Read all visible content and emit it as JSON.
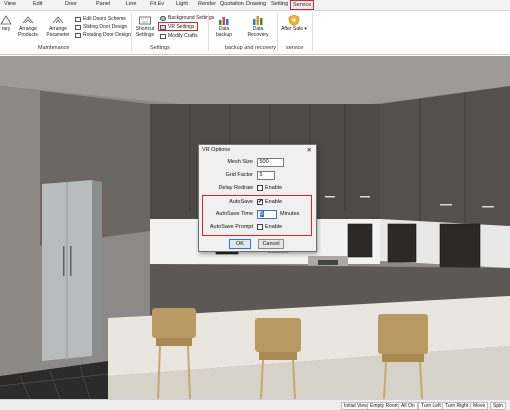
{
  "menu": {
    "items": [
      "View",
      "Edit",
      "Door",
      "Panel",
      "Line",
      "Fit Ev",
      "Light",
      "Render",
      "Quotation",
      "Drawing",
      "Setting",
      "Service"
    ],
    "active": "Service"
  },
  "ribbon": {
    "ary_label": "rary",
    "arrange_products": "Arrange Products",
    "arrange_parameter": "Arrange Parameter",
    "edit_doors_scheme": "Edit Doors Scheme",
    "sliding_door_design": "Sliding Door Design",
    "rotating_door_design": "Rotating Door Design",
    "shortcut_settings": "Shortcut Settings",
    "background_settings": "Background Settings",
    "vr_settings": "VR Settings",
    "modify_crafts": "Modify Crafts",
    "data_backup": "Data backup",
    "data_recovery": "Data Recovery",
    "after_sale": "After Sale ▾",
    "groups": {
      "maintenance": "Maintenance",
      "settings": "Settings",
      "backup": "backup and recovery",
      "service": "service"
    }
  },
  "dialog": {
    "title": "VR Options",
    "close": "✕",
    "mesh_size_label": "Mesh Size",
    "mesh_size_value": "500",
    "grid_factor_label": "Grid Factor",
    "grid_factor_value": "5",
    "delay_redraw_label": "Delay Redraw",
    "delay_redraw_enable": "Enable",
    "autosave_label": "AutoSave",
    "autosave_check": "✔",
    "autosave_enable": "Enable",
    "autosave_time_label": "AutoSave Time",
    "autosave_time_value": "5",
    "autosave_time_unit": "Minutes",
    "autosave_prompt_label": "AutoSave Prompt",
    "autosave_prompt_enable": "Enable",
    "ok_label": "OK",
    "cancel_label": "Cancel"
  },
  "statusbar": {
    "initial_view": "Initial View",
    "empty_room": "Empty Room",
    "all_on": "All On",
    "turn_left": "Turn Left",
    "turn_right": "Turn Right",
    "move": "Move",
    "spin": "Spin"
  },
  "colors": {
    "highlight": "#e0202a",
    "selection": "#3778d6",
    "cabinet_dark": "#4a4644",
    "countertop": "#e9e6df",
    "stool_seat": "#b89a62"
  }
}
